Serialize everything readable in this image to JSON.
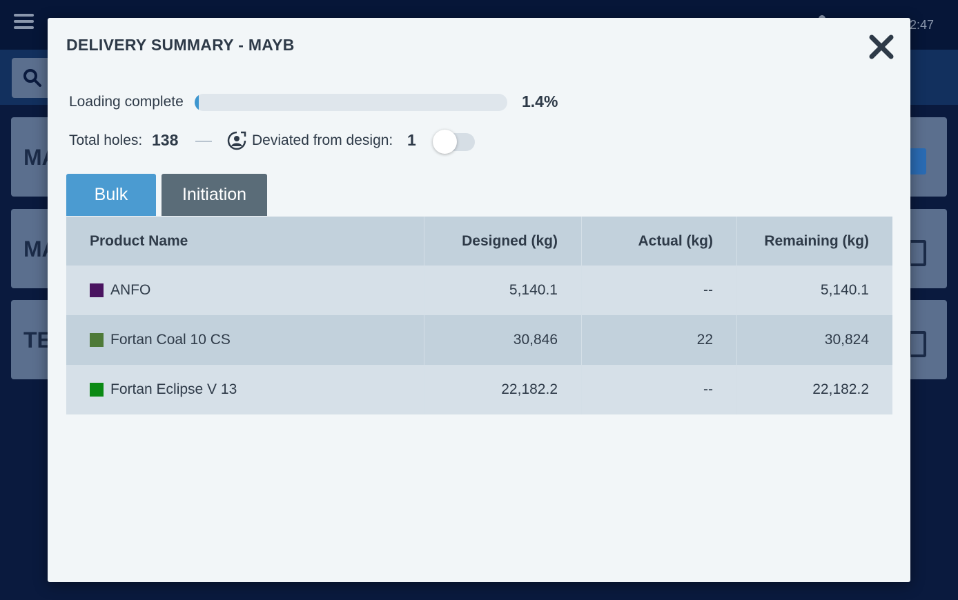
{
  "app": {
    "clock": "2:47",
    "cards": [
      {
        "title": "MA"
      },
      {
        "title": "MA"
      },
      {
        "title": "TE"
      }
    ]
  },
  "modal": {
    "title": "DELIVERY SUMMARY - MAYB",
    "loading_label": "Loading complete",
    "loading_progress": 1.4,
    "loading_pct": "1.4%",
    "holes_label": "Total holes:",
    "holes_value": "138",
    "deviated_label": "Deviated from design:",
    "deviated_value": "1",
    "deviated_toggle_on": false,
    "tabs": [
      {
        "label": "Bulk",
        "active": true
      },
      {
        "label": "Initiation",
        "active": false
      }
    ],
    "table": {
      "headers": [
        "Product Name",
        "Designed (kg)",
        "Actual (kg)",
        "Remaining (kg)"
      ],
      "rows": [
        {
          "name": "ANFO",
          "color": "#4a1460",
          "designed": "5,140.1",
          "actual": "--",
          "remaining": "5,140.1"
        },
        {
          "name": "Fortan Coal 10 CS",
          "color": "#4e7a38",
          "designed": "30,846",
          "actual": "22",
          "remaining": "30,824"
        },
        {
          "name": "Fortan Eclipse V 13",
          "color": "#0b8a14",
          "designed": "22,182.2",
          "actual": "--",
          "remaining": "22,182.2"
        }
      ]
    }
  }
}
